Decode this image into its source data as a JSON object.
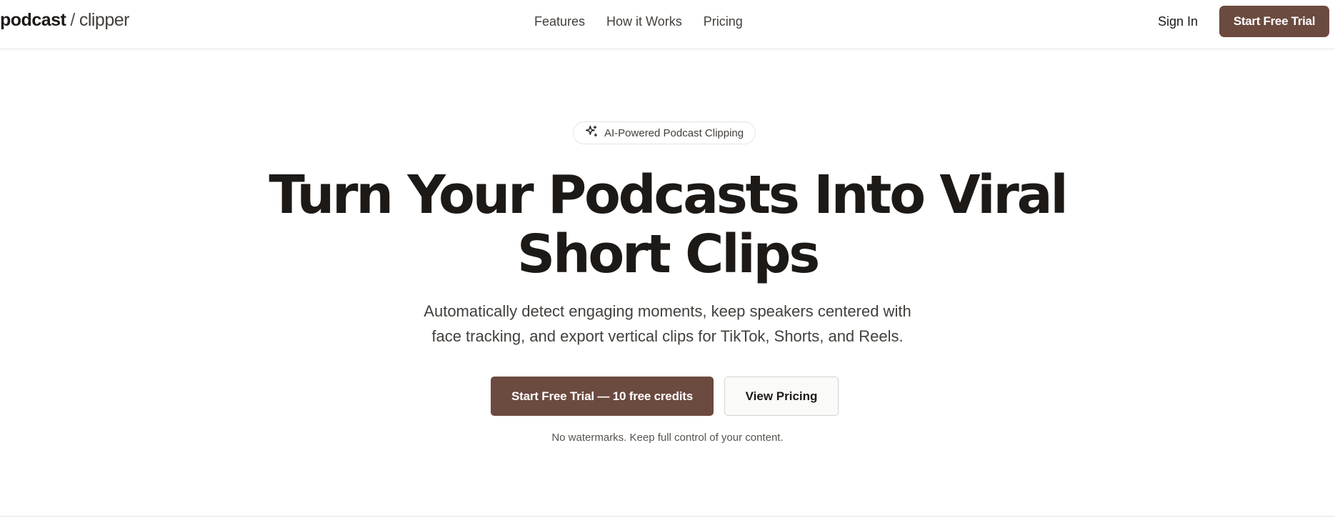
{
  "header": {
    "logo": {
      "primary": "podcast",
      "separator": "/",
      "secondary": "clipper"
    },
    "nav": [
      {
        "label": "Features"
      },
      {
        "label": "How it Works"
      },
      {
        "label": "Pricing"
      }
    ],
    "sign_in_label": "Sign In",
    "cta_label": "Start Free Trial"
  },
  "hero": {
    "badge": {
      "icon": "sparkles-icon",
      "label": "AI-Powered Podcast Clipping"
    },
    "headline_line1": "Turn Your Podcasts Into Viral",
    "headline_line2": "Short Clips",
    "subhead_line1": "Automatically detect engaging moments, keep speakers centered with",
    "subhead_line2": "face tracking, and export vertical clips for TikTok, Shorts, and Reels.",
    "primary_cta": "Start Free Trial — 10 free credits",
    "secondary_cta": "View Pricing",
    "note": "No watermarks. Keep full control of your content."
  },
  "colors": {
    "brand": "#6b4a3f",
    "text": "#1c1917",
    "muted": "#44403c",
    "border": "#e7e5e4",
    "background": "#ffffff"
  }
}
